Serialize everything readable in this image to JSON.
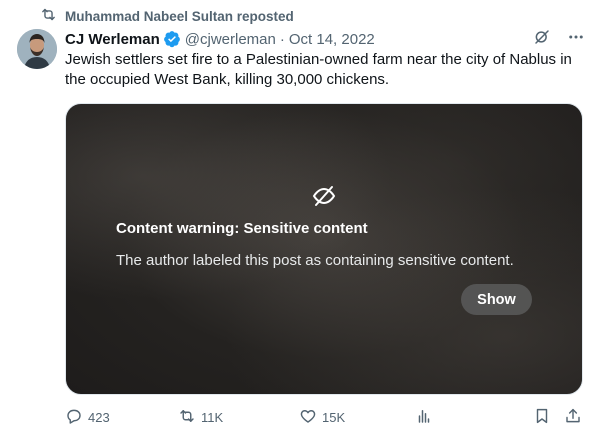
{
  "repost": {
    "text": "Muhammad Nabeel Sultan reposted",
    "icon": "repost-icon"
  },
  "tweet": {
    "author_name": "CJ Werleman",
    "handle": "@cjwerleman",
    "separator": "·",
    "date": "Oct 14, 2022",
    "text": "Jewish settlers set fire to a Palestinian-owned farm near the city of Nablus in the occupied West Bank, killing 30,000 chickens."
  },
  "media": {
    "warning_title": "Content warning: Sensitive content",
    "warning_desc": "The author labeled this post as containing sensitive content.",
    "show_label": "Show"
  },
  "metrics": {
    "replies": "423",
    "reposts": "11K",
    "likes": "15K"
  },
  "colors": {
    "text": "#0f1419",
    "secondary": "#536471",
    "verified": "#1d9bf0"
  }
}
